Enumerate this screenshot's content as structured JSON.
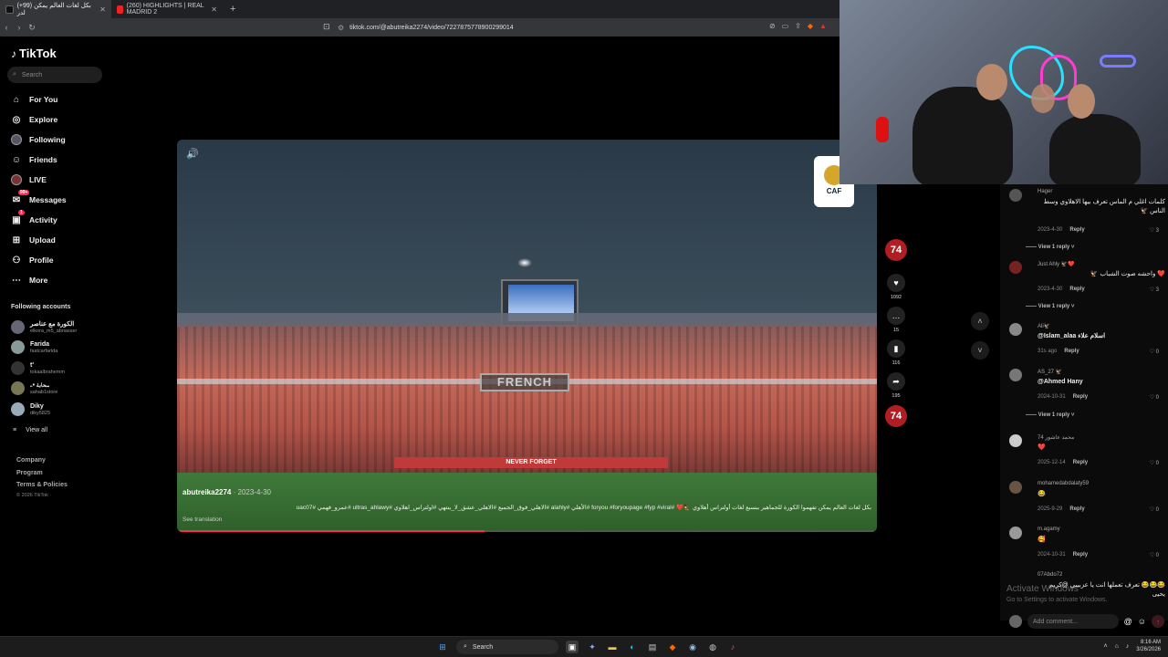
{
  "browser": {
    "tabs": [
      {
        "title": "(+99) بكل لغات العالم يمكن لدر",
        "active": true
      },
      {
        "title": "(260) HIGHLIGHTS | REAL MADRID 2",
        "active": false
      }
    ],
    "url": "tiktok.com/@abutreika2274/video/7227875778900299014"
  },
  "sidebar": {
    "brand": "TikTok",
    "search_placeholder": "Search",
    "nav": [
      {
        "label": "For You",
        "icon": "home-icon"
      },
      {
        "label": "Explore",
        "icon": "compass-icon"
      },
      {
        "label": "Following",
        "icon": "avatar-icon"
      },
      {
        "label": "Friends",
        "icon": "friends-icon"
      },
      {
        "label": "LIVE",
        "icon": "live-icon"
      },
      {
        "label": "Messages",
        "icon": "message-icon",
        "badge": "99+"
      },
      {
        "label": "Activity",
        "icon": "bell-icon",
        "badge": "1"
      },
      {
        "label": "Upload",
        "icon": "plus-icon"
      },
      {
        "label": "Profile",
        "icon": "person-icon"
      },
      {
        "label": "More",
        "icon": "more-icon"
      }
    ],
    "following_title": "Following accounts",
    "accounts": [
      {
        "name": "الكورة مع عناصر",
        "handle": "elkora_m5_abnasser"
      },
      {
        "name": "Farida",
        "handle": "fastcarfarida"
      },
      {
        "name": "t'",
        "handle": "tokaalbrahemm"
      },
      {
        "name": "سحابة •⁠ۦ",
        "handle": "sahab1store"
      },
      {
        "name": "Diky",
        "handle": "diky5825"
      }
    ],
    "view_all": "View all",
    "footer_links": [
      "Company",
      "Program",
      "Terms & Policies"
    ],
    "copyright": "© 2026 TikTok"
  },
  "video": {
    "author": "abutreika2274",
    "date": "2023-4-30",
    "scoreboard_text": "FRENCH",
    "banner_text": "NEVER FORGET",
    "caf_text": "CAF",
    "description": "بكل لغات العالم يمكن تفهموا الكورة للجماهير ببسبع لغات أولتراس أهلاوي 🦅❤️ #foryou #foryoupage #fyp #viral #الأهلي #alahly #الاهلي_فوق_الجميع #الاهلي_عشق_لا_ينتهي #اولتراس_اهلاوي #ultras_ahlawy #عمرو_فهمي #uac07",
    "see_translation": "See translation",
    "progress": 0.44
  },
  "actions": {
    "avatar_text": "74",
    "likes": "1092",
    "comments": "15",
    "saves": "116",
    "shares": "195"
  },
  "comments": [
    {
      "user": "Hager",
      "text": "كلمات اغلي م الماس تعرف بيها الاهلاوي وسط الناس 🦅",
      "date": "2023-4-30",
      "likes": "3",
      "replies": "View 1 reply"
    },
    {
      "user": "Just Ahly 🦅❤️",
      "text": "❤️ واحشه صوت الشباب 🦅",
      "date": "2023-4-30",
      "likes": "3",
      "replies": "View 1 reply"
    },
    {
      "user": "Ali🦅",
      "text": "@Islam_alaa اسلام علاء",
      "date": "31s ago",
      "likes": "0",
      "replies": ""
    },
    {
      "user": "AS_27 🦅",
      "text": "@Ahmed Hany",
      "date": "2024-10-31",
      "likes": "0",
      "replies": "View 1 reply"
    },
    {
      "user": "محمد عاشور 74",
      "text": "❤️",
      "date": "2025-12-14",
      "likes": "0",
      "replies": ""
    },
    {
      "user": "mohamedabdalaty59",
      "text": "😂",
      "date": "2025-9-29",
      "likes": "0",
      "replies": ""
    },
    {
      "user": "m.agamy",
      "text": "🥰",
      "date": "2024-10-31",
      "likes": "0",
      "replies": ""
    },
    {
      "user": "07Abdo72",
      "text": "😂😂😂 تعرف تعملها انت يا عزبيبي @كريم يحيى",
      "date": "",
      "likes": "",
      "replies": ""
    }
  ],
  "reply_label": "Reply",
  "watermark": {
    "line1": "Activate Windows",
    "line2": "Go to Settings to activate Windows."
  },
  "add_comment_placeholder": "Add comment...",
  "taskbar": {
    "search": "Search",
    "time": "8:16 AM",
    "date": "3/26/2026"
  }
}
